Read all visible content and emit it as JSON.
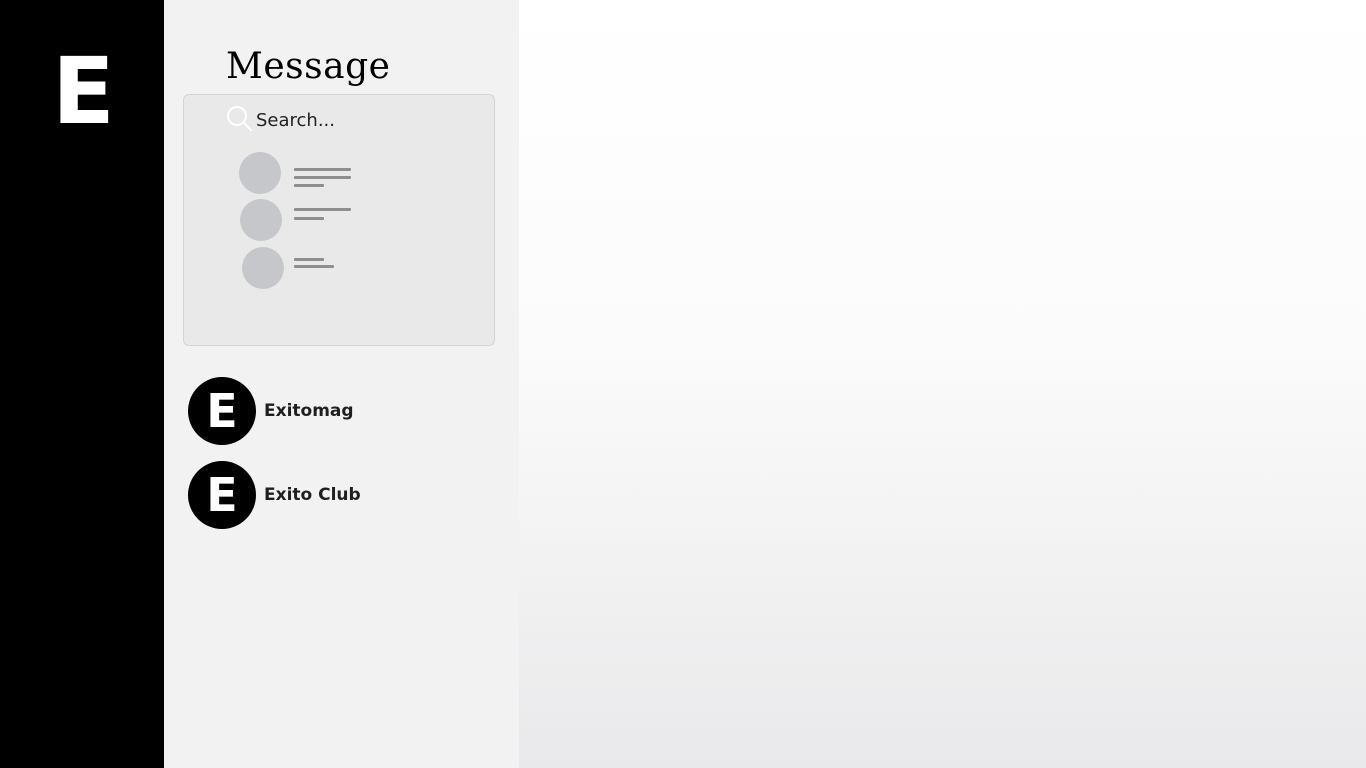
{
  "app": {
    "logo_letter": "E"
  },
  "panel": {
    "title": "Message",
    "search": {
      "placeholder": "Search...",
      "value": ""
    }
  },
  "conversations": [
    {
      "name": "Exitomag",
      "avatar_letter": "E"
    },
    {
      "name": "Exito Club",
      "avatar_letter": "E"
    }
  ],
  "colors": {
    "rail": "#000000",
    "panel": "#f2f2f2",
    "card": "#e9e9e9",
    "avatar": "#000000",
    "skeleton_avatar": "#c5c7ca",
    "skeleton_line": "#8e8e8e"
  },
  "icons": {
    "search": "search-icon"
  }
}
